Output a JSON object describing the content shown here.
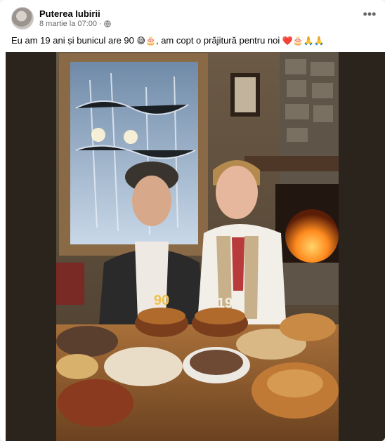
{
  "post": {
    "author": "Puterea Iubirii",
    "timestamp": "8 martie la 07:00",
    "visibility_separator": "·",
    "visibility_icon": "globe-icon",
    "more_label": "•••",
    "caption_text": "Eu am 19 ani și bunicul are 90",
    "caption_emoji_1": "😅🎂",
    "caption_text_2": ", am copt o prăjitură pentru noi",
    "caption_emoji_2": "❤️🎂🙏🙏"
  },
  "photo": {
    "candles_left": "90",
    "candles_right": "19"
  }
}
